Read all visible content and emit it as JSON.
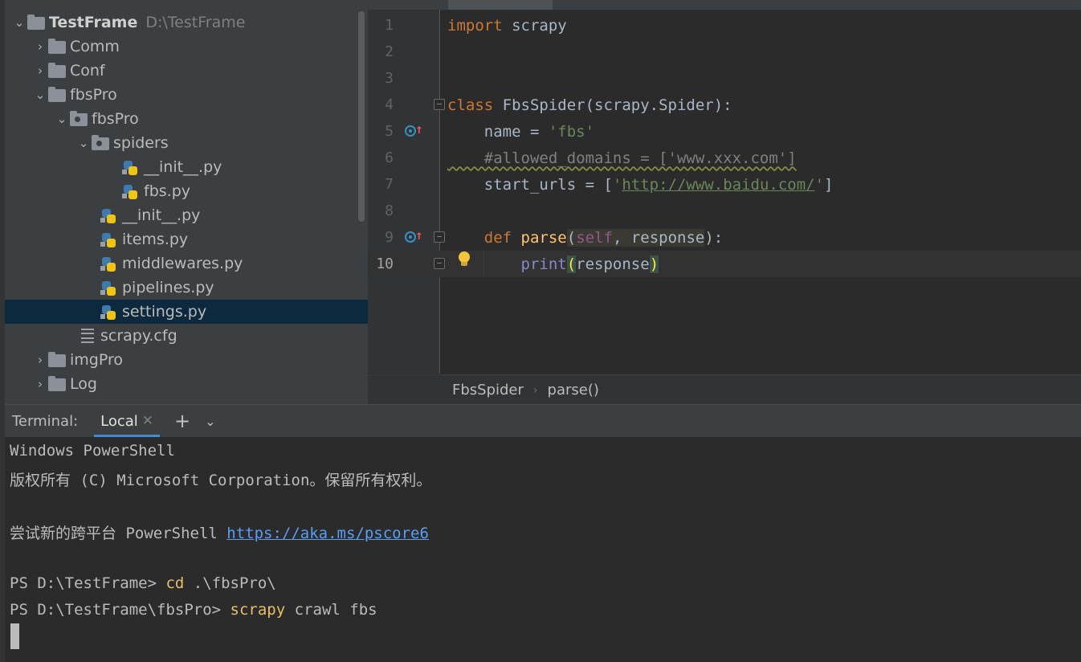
{
  "project": {
    "root_name": "TestFrame",
    "root_path": "D:\\TestFrame",
    "items": [
      {
        "label": "Comm"
      },
      {
        "label": "Conf"
      },
      {
        "label": "fbsPro"
      },
      {
        "label": "fbsPro"
      },
      {
        "label": "spiders"
      },
      {
        "label": "__init__.py"
      },
      {
        "label": "fbs.py"
      },
      {
        "label": "__init__.py"
      },
      {
        "label": "items.py"
      },
      {
        "label": "middlewares.py"
      },
      {
        "label": "pipelines.py"
      },
      {
        "label": "settings.py"
      },
      {
        "label": "scrapy.cfg"
      },
      {
        "label": "imgPro"
      },
      {
        "label": "Log"
      }
    ]
  },
  "editor": {
    "line_numbers": [
      "1",
      "2",
      "3",
      "4",
      "5",
      "6",
      "7",
      "8",
      "9",
      "10"
    ],
    "lines": {
      "l1": {
        "kw": "import",
        "rest": " scrapy"
      },
      "l4": {
        "kw": "class",
        "rest": " FbsSpider(scrapy.Spider):"
      },
      "l5": {
        "pre": "    name = ",
        "str": "'fbs'"
      },
      "l6": {
        "comment": "    #allowed_domains = ['www.xxx.com']"
      },
      "l7": {
        "pre": "    start_urls = [",
        "q1": "'",
        "url": "http://www.baidu.com/",
        "q2": "'",
        "post": "]"
      },
      "l9": {
        "pre": "    ",
        "kw": "def",
        "name": " parse",
        "open": "(",
        "self": "self",
        "params": ", response",
        "close": "):"
      },
      "l10": {
        "pre": "        ",
        "builtin": "print",
        "open": "(",
        "arg": "response",
        "close": ")"
      }
    },
    "breadcrumbs": [
      "FbsSpider",
      "parse()"
    ]
  },
  "terminal": {
    "title": "Terminal:",
    "tab_label": "Local",
    "lines": {
      "l1": "Windows PowerShell",
      "l2": "版权所有 (C) Microsoft Corporation。保留所有权利。",
      "l3_pre": "尝试新的跨平台 PowerShell ",
      "l3_link": "https://aka.ms/pscore6",
      "l4_prompt": "PS D:\\TestFrame> ",
      "l4_cmd": "cd",
      "l4_rest": " .\\fbsPro\\",
      "l5_prompt": "PS D:\\TestFrame\\fbsPro> ",
      "l5_cmd": "scrapy",
      "l5_rest": " crawl fbs"
    }
  },
  "colors": {
    "keyword": "#cc7832",
    "string": "#6a8759",
    "selection": "#0d293e",
    "link": "#589df6"
  }
}
